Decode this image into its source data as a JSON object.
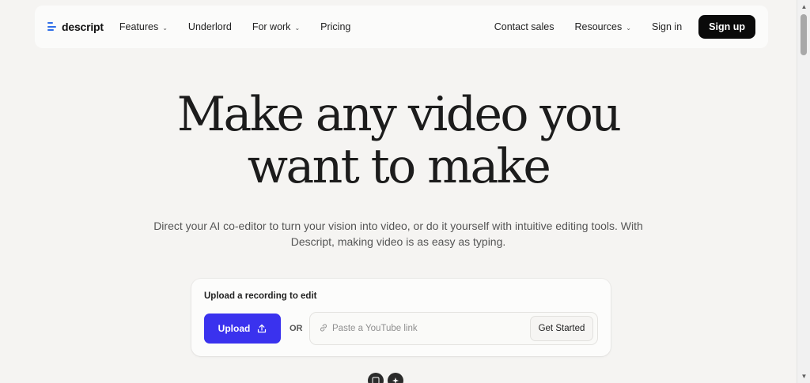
{
  "brand": {
    "name": "descript",
    "accent": "#2f6ee8"
  },
  "nav": {
    "left_items": [
      {
        "label": "Features",
        "has_dropdown": true
      },
      {
        "label": "Underlord",
        "has_dropdown": false
      },
      {
        "label": "For work",
        "has_dropdown": true
      },
      {
        "label": "Pricing",
        "has_dropdown": false
      }
    ],
    "right_items": [
      {
        "label": "Contact sales",
        "has_dropdown": false
      },
      {
        "label": "Resources",
        "has_dropdown": true
      },
      {
        "label": "Sign in",
        "has_dropdown": false
      }
    ],
    "signup_label": "Sign up"
  },
  "hero": {
    "headline_line1": "Make any video you",
    "headline_line2": "want to make",
    "subtitle_line1": "Direct your AI co-editor to turn your vision into video, or do it yourself with intuitive editing tools. With",
    "subtitle_line2": "Descript, making video is as easy as typing."
  },
  "upload_card": {
    "title": "Upload a recording to edit",
    "upload_label": "Upload",
    "upload_color": "#3a32ee",
    "or_label": "OR",
    "youtube_placeholder": "Paste a YouTube link",
    "get_started_label": "Get Started"
  },
  "icons": {
    "logo": "descript-logo-icon",
    "dropdown": "chevron-down-icon",
    "upload": "upload-icon",
    "link": "link-icon"
  }
}
